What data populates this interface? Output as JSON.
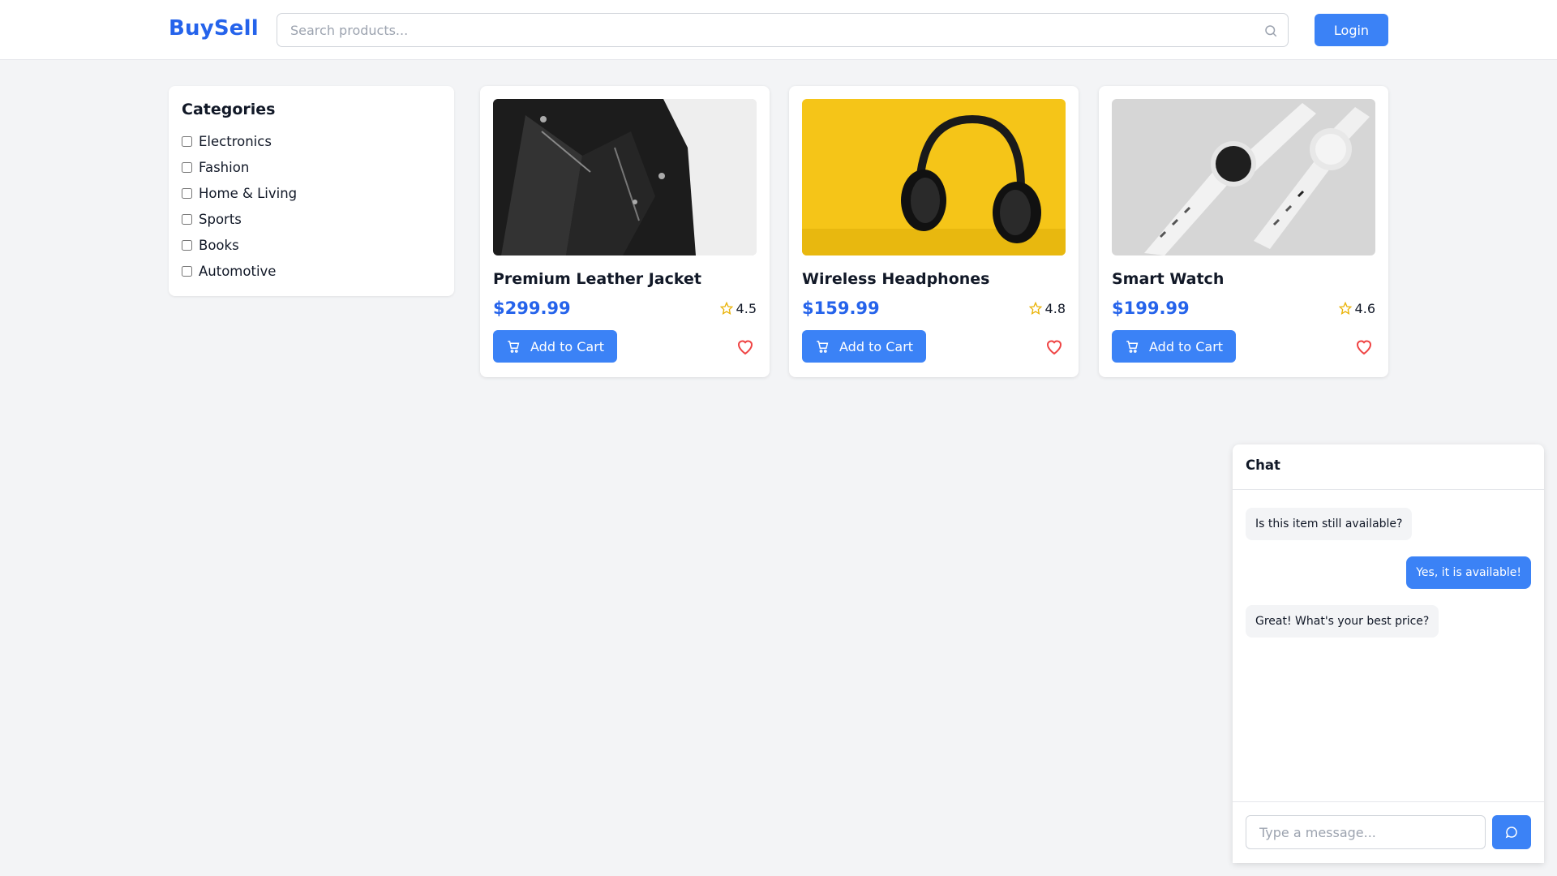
{
  "header": {
    "logo": "BuySell",
    "search_placeholder": "Search products...",
    "login_label": "Login"
  },
  "sidebar": {
    "title": "Categories",
    "categories": [
      "Electronics",
      "Fashion",
      "Home & Living",
      "Sports",
      "Books",
      "Automotive"
    ]
  },
  "products": [
    {
      "title": "Premium Leather Jacket",
      "price": "$299.99",
      "rating": "4.5",
      "cart_label": "Add to Cart",
      "image": "leather-jacket-photo"
    },
    {
      "title": "Wireless Headphones",
      "price": "$159.99",
      "rating": "4.8",
      "cart_label": "Add to Cart",
      "image": "headphones-photo"
    },
    {
      "title": "Smart Watch",
      "price": "$199.99",
      "rating": "4.6",
      "cart_label": "Add to Cart",
      "image": "smart-watch-photo"
    }
  ],
  "chat": {
    "title": "Chat",
    "messages": [
      {
        "from": "buyer",
        "text": "Is this item still available?"
      },
      {
        "from": "seller",
        "text": "Yes, it is available!"
      },
      {
        "from": "buyer",
        "text": "Great! What's your best price?"
      }
    ],
    "input_placeholder": "Type a message..."
  },
  "colors": {
    "accent": "#3b82f6",
    "brand": "#2563eb",
    "star": "#eab308",
    "heart": "#ef4444",
    "background": "#f3f4f6"
  }
}
